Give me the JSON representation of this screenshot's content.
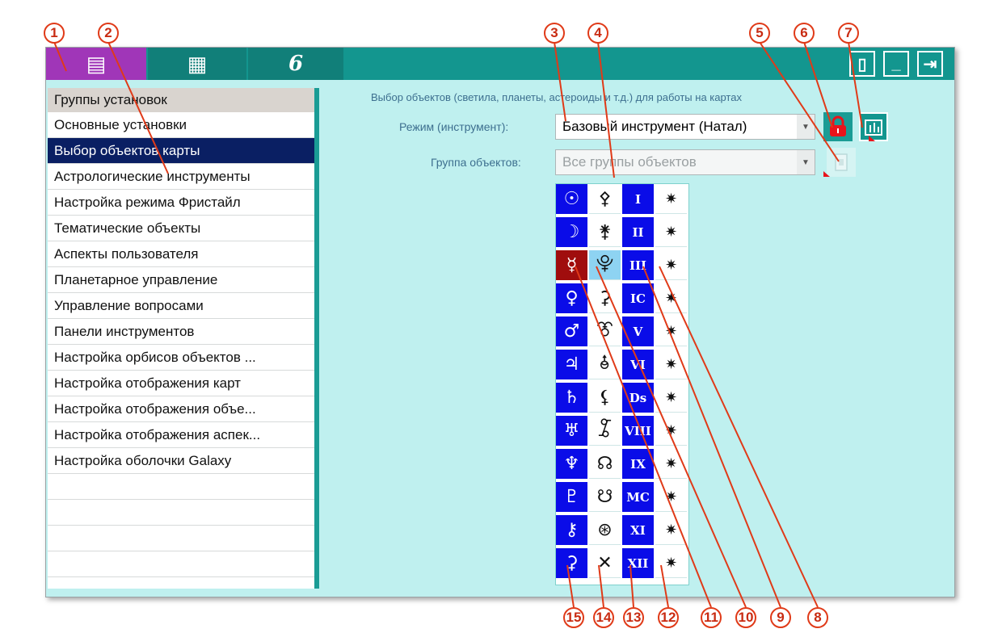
{
  "toolbar": {
    "tab1_icon": "settings-list-icon",
    "tab2_icon": "calculator-icon",
    "tab3_icon": "galaxy-logo-icon",
    "tab3_glyph": "6",
    "tab1_glyph": "▤",
    "tab2_glyph": "▦",
    "panel_btn": "▯",
    "minimize_btn": "_",
    "exit_btn": "⇥"
  },
  "sidebar": {
    "header": "Группы установок",
    "items": [
      "Основные установки",
      "Выбор объектов карты",
      "Астрологические инструменты",
      "Настройка режима Фристайл",
      "Тематические объекты",
      "Аспекты пользователя",
      "Планетарное управление",
      "Управление вопросами",
      "Панели инструментов",
      "Настройка орбисов объектов ...",
      "Настройка отображения карт",
      "Настройка отображения объе...",
      "Настройка отображения аспек...",
      "Настройка оболочки Galaxy"
    ],
    "selected_index": 1
  },
  "panel": {
    "title": "Выбор объектов (светила, планеты, астероиды и т.д.) для работы на картах",
    "mode_label": "Режим (инструмент):",
    "mode_value": "Базовый инструмент (Натал)",
    "group_label": "Группа объектов:",
    "group_value": "Все группы объектов"
  },
  "grid": {
    "col1": [
      "☉",
      "☽",
      "☿",
      "♀",
      "♂",
      "♃",
      "♄",
      "♅",
      "♆",
      "♇",
      "⚷",
      "⚳"
    ],
    "col2": [
      "⚴",
      "⚵",
      "⯓",
      "⚳",
      "⯔",
      "⯗",
      "⚸",
      "⯙",
      "☊",
      "☋",
      "⊛",
      "✕"
    ],
    "col3": [
      "I",
      "II",
      "III",
      "IC",
      "V",
      "VI",
      "Ds",
      "VIII",
      "IX",
      "MC",
      "XI",
      "XII"
    ],
    "col4": [
      "✷",
      "✷",
      "✷",
      "✷",
      "✷",
      "✷",
      "✷",
      "✷",
      "✷",
      "✷",
      "✷",
      "✷"
    ],
    "highlight_red": "☿",
    "highlight_light": "⯓"
  },
  "callouts": [
    "1",
    "2",
    "3",
    "4",
    "5",
    "6",
    "7",
    "8",
    "9",
    "10",
    "11",
    "12",
    "13",
    "14",
    "15"
  ],
  "colors": {
    "accent_teal": "#13968f",
    "active_tab": "#a036b8",
    "panel_bg": "#bff0ef",
    "callout_red": "#e03a18",
    "cell_blue": "#0a0ce8",
    "selected_row": "#0a1f63"
  }
}
